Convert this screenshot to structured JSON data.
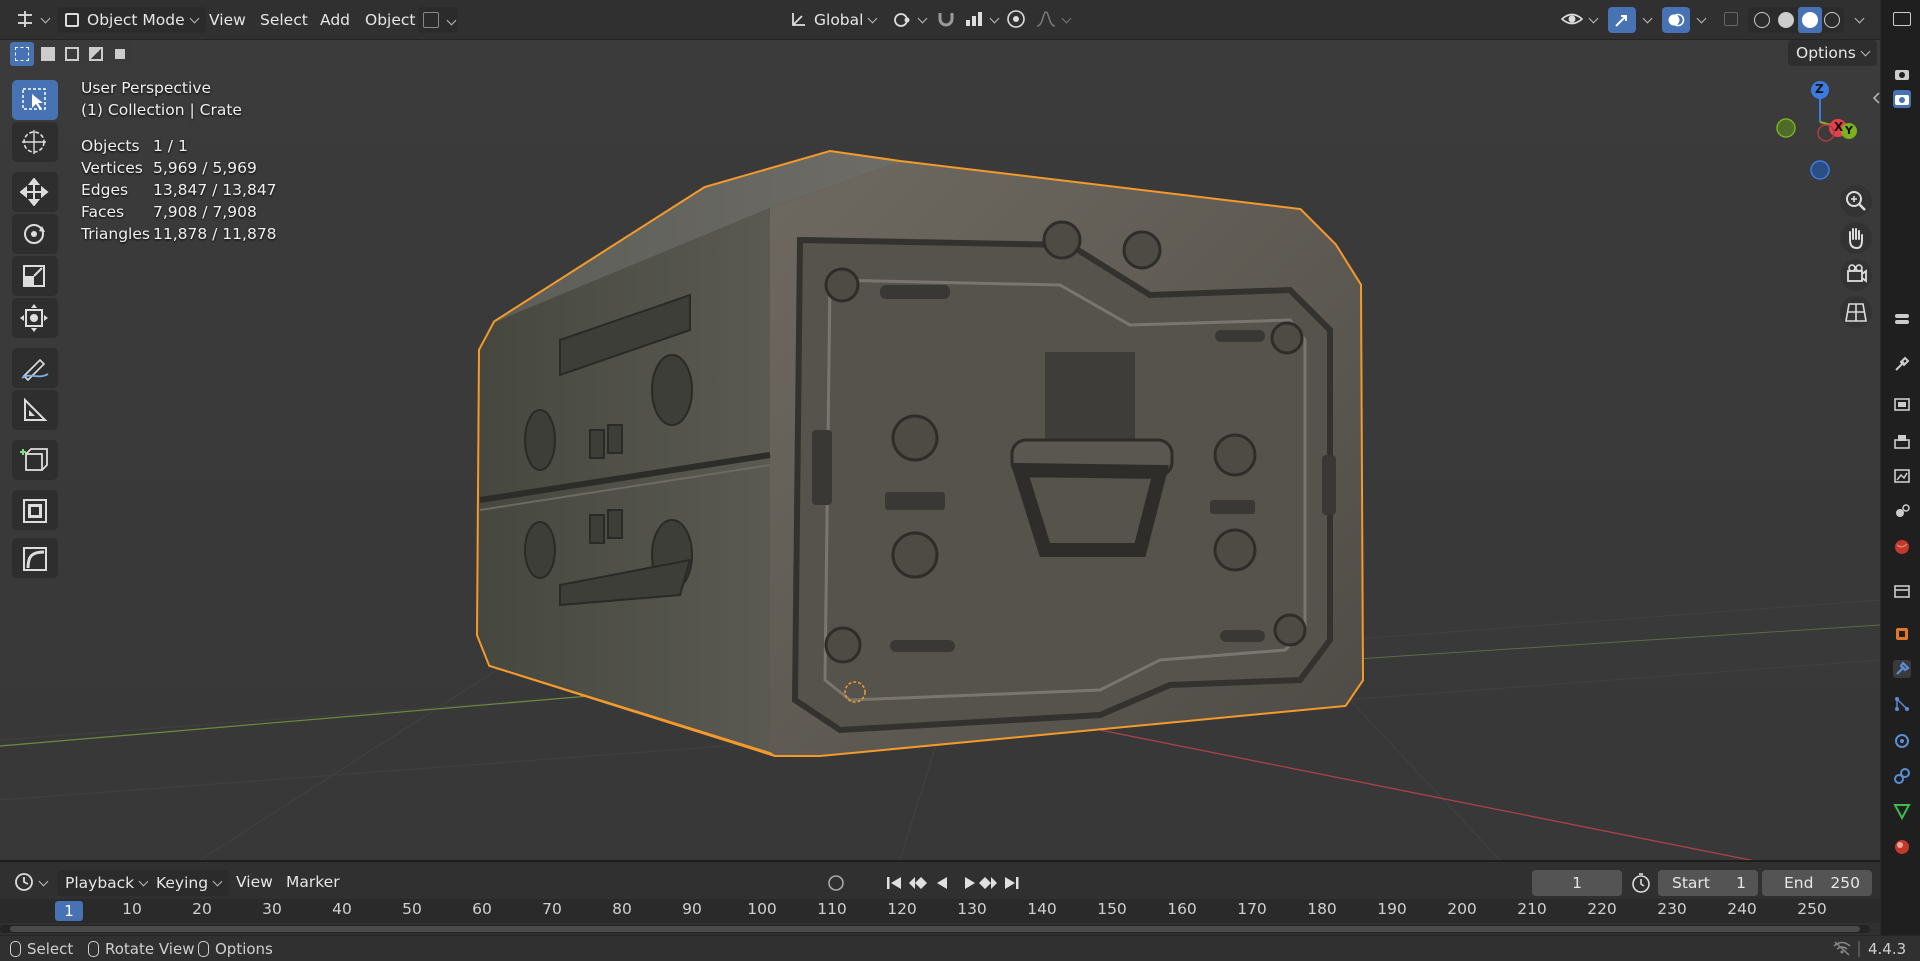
{
  "header": {
    "mode_label": "Object Mode",
    "menu": [
      "View",
      "Select",
      "Add",
      "Object"
    ],
    "transform_orientation": "Global",
    "options_label": "Options"
  },
  "overlay": {
    "view_name": "User Perspective",
    "collection_line": "(1) Collection | Crate",
    "stats": [
      {
        "label": "Objects",
        "value": "1 / 1"
      },
      {
        "label": "Vertices",
        "value": "5,969 / 5,969"
      },
      {
        "label": "Edges",
        "value": "13,847 / 13,847"
      },
      {
        "label": "Faces",
        "value": "7,908 / 7,908"
      },
      {
        "label": "Triangles",
        "value": "11,878 / 11,878"
      }
    ]
  },
  "gizmo": {
    "z": "Z",
    "x": "X",
    "y": "Y"
  },
  "colors": {
    "selection_outline": "#f39a2a",
    "accent_blue": "#4772b3",
    "axis_x": "#e8404f",
    "axis_y": "#7cb01f",
    "axis_z": "#3a7ce0"
  },
  "timeline": {
    "menu": [
      "Playback",
      "Keying",
      "View",
      "Marker"
    ],
    "current_frame": "1",
    "start_label": "Start",
    "start_value": "1",
    "end_label": "End",
    "end_value": "250",
    "ruler_current": "1",
    "ruler_ticks": [
      "10",
      "20",
      "30",
      "40",
      "50",
      "60",
      "70",
      "80",
      "90",
      "100",
      "110",
      "120",
      "130",
      "140",
      "150",
      "160",
      "170",
      "180",
      "190",
      "200",
      "210",
      "220",
      "230",
      "240",
      "250"
    ]
  },
  "status": {
    "select": "Select",
    "rotate_view": "Rotate View",
    "options": "Options",
    "version": "4.4.3"
  }
}
